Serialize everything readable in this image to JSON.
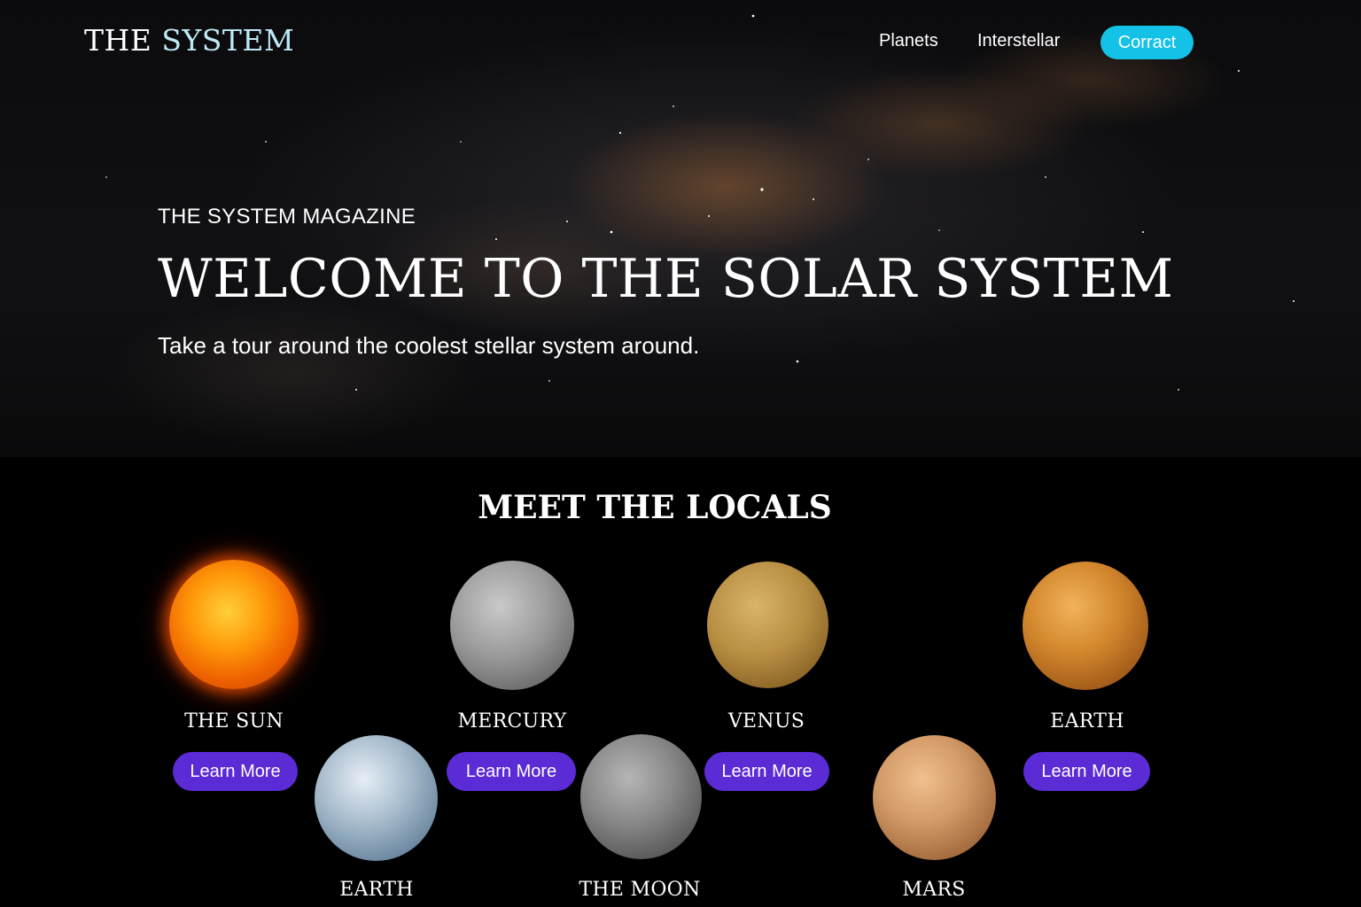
{
  "header": {
    "logo_part1": "THE",
    "logo_part2": "SYSTEM",
    "nav": [
      {
        "label": "Planets"
      },
      {
        "label": "Interstellar"
      }
    ],
    "contact_label": "Corract"
  },
  "hero": {
    "kicker": "THE SYSTEM MAGAZINE",
    "title": "WELCOME TO THE SOLAR SYSTEM",
    "subtitle": "Take a tour around the coolest stellar system around."
  },
  "locals": {
    "title": "MEET THE LOCALS",
    "cards": [
      {
        "name": "THE SUN",
        "button": "Learn More"
      },
      {
        "name": "MERCURY",
        "button": "Learn More"
      },
      {
        "name": "VENUS",
        "button": "Learn More"
      },
      {
        "name": "EARTH",
        "button": "Learn More"
      },
      {
        "name": "EARTH"
      },
      {
        "name": "THE MOON"
      },
      {
        "name": "MARS"
      }
    ]
  },
  "colors": {
    "contact_button": "#13c2e6",
    "learn_more_button": "#5b2bd6",
    "logo_accent": "#bfe9f6",
    "background": "#000000"
  }
}
